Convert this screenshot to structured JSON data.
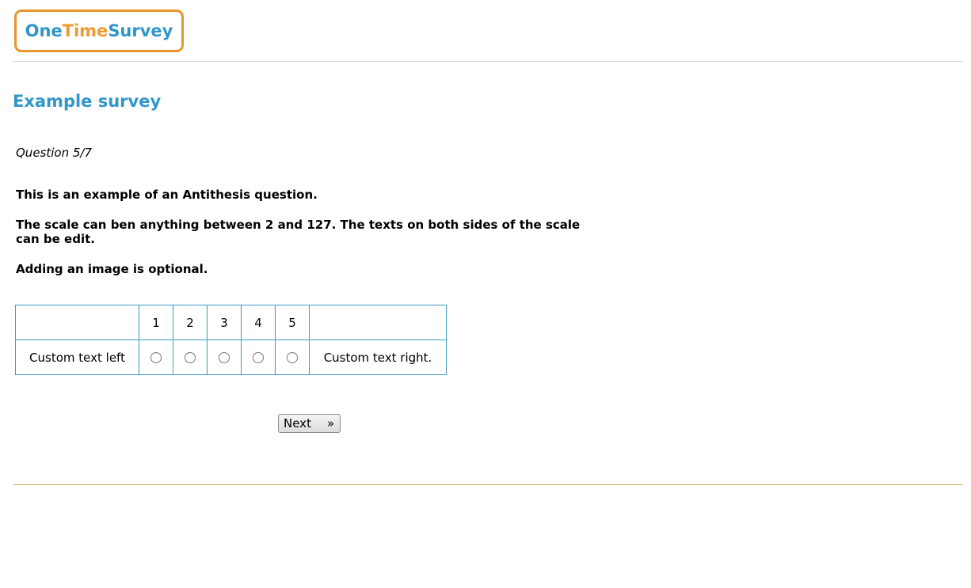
{
  "logo": {
    "part1": "One",
    "part2": "Time",
    "part3": "Survey"
  },
  "survey": {
    "title": "Example survey",
    "counter": "Question 5/7"
  },
  "question": {
    "line1": "This is an example of an Antithesis question.",
    "line2": "The scale can ben anything between 2 and 127. The texts on both sides of the scale can be edit.",
    "line3": "Adding an image is optional."
  },
  "scale": {
    "left_label": "Custom text left",
    "right_label": "Custom text right.",
    "options": [
      "1",
      "2",
      "3",
      "4",
      "5"
    ]
  },
  "navigation": {
    "next_label": "Next",
    "next_arrow": "»"
  },
  "colors": {
    "brand_blue": "#3197c9",
    "brand_orange": "#e8952b",
    "table_border": "#3d9ac3",
    "footer_line": "#d9a85a"
  }
}
